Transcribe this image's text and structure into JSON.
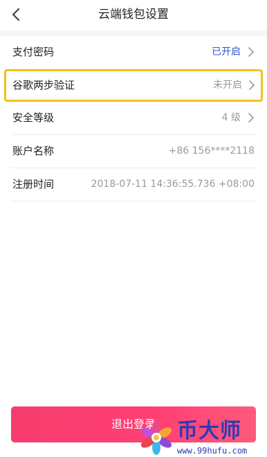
{
  "header": {
    "title": "云端钱包设置"
  },
  "settings": {
    "payment_password": {
      "label": "支付密码",
      "value": "已开启"
    },
    "google_2fa": {
      "label": "谷歌两步验证",
      "value": "未开启"
    },
    "security_level": {
      "label": "安全等级",
      "value": "4 级"
    },
    "account_name": {
      "label": "账户名称",
      "value": "+86 156****2118"
    },
    "register_time": {
      "label": "注册时间",
      "value": "2018-07-11 14:36:55.736 +08:00"
    }
  },
  "logout": {
    "label": "退出登录"
  },
  "watermark": {
    "brand": "币大师",
    "url": "www.99hufu.com"
  },
  "colors": {
    "accent_blue": "#2f5bd3",
    "highlight_yellow": "#f2c318",
    "logout_pink": "#f73d6e",
    "watermark_blue": "#2e3bb3"
  }
}
